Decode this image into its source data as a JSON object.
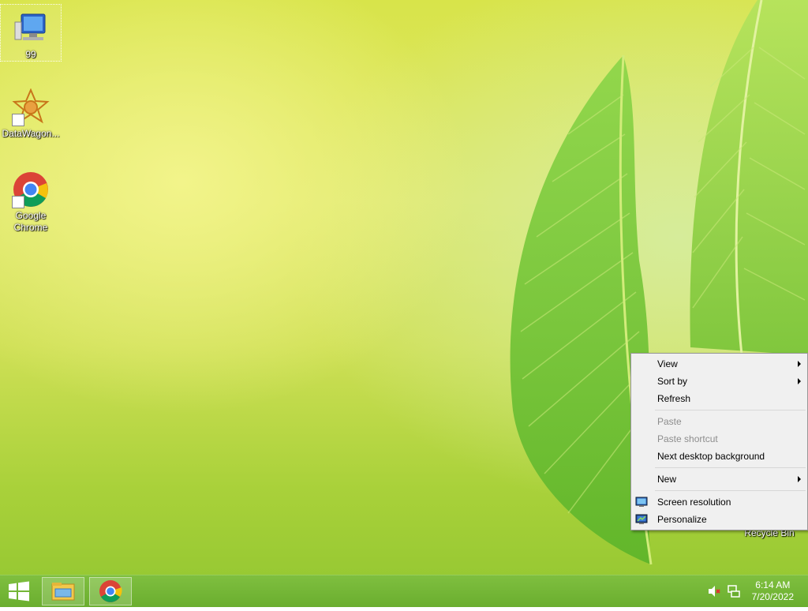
{
  "desktop": {
    "icons": [
      {
        "label": "99",
        "icon": "computer-icon"
      },
      {
        "label": "DataWagon...",
        "icon": "datawagon-icon"
      },
      {
        "label": "Google Chrome",
        "icon": "chrome-icon"
      },
      {
        "label": "Recycle Bin",
        "icon": "recycle-bin-icon"
      }
    ]
  },
  "context_menu": {
    "items": [
      {
        "label": "View",
        "submenu": true,
        "enabled": true
      },
      {
        "label": "Sort by",
        "submenu": true,
        "enabled": true
      },
      {
        "label": "Refresh",
        "enabled": true
      },
      {
        "label": "Paste",
        "enabled": false
      },
      {
        "label": "Paste shortcut",
        "enabled": false
      },
      {
        "label": "Next desktop background",
        "enabled": true
      },
      {
        "label": "New",
        "submenu": true,
        "enabled": true
      },
      {
        "label": "Screen resolution",
        "icon": "screen-resolution-icon",
        "enabled": true
      },
      {
        "label": "Personalize",
        "icon": "personalize-icon",
        "enabled": true
      }
    ]
  },
  "taskbar": {
    "start_icon": "windows-logo-icon",
    "pinned": [
      {
        "icon": "file-explorer-icon"
      },
      {
        "icon": "chrome-icon"
      }
    ],
    "tray": {
      "icons": [
        "volume-muted-icon",
        "network-icon"
      ],
      "time": "6:14 AM",
      "date": "7/20/2022"
    }
  },
  "colors": {
    "taskbar": "#6aae2f",
    "menu_bg": "#f0f0f0",
    "disabled_text": "#8d8d8d"
  }
}
